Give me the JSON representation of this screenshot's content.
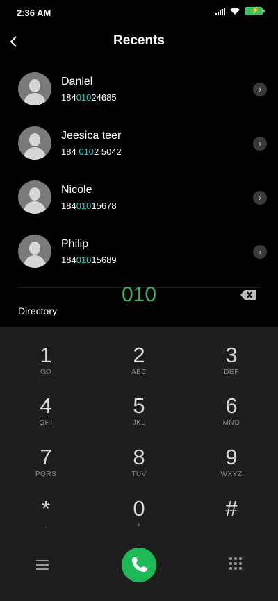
{
  "status_bar": {
    "time": "2:36 AM"
  },
  "header": {
    "title": "Recents"
  },
  "recents": [
    {
      "name": "Daniel",
      "number_prefix": "184",
      "number_match": "010",
      "number_suffix": "24685"
    },
    {
      "name": "Jeesica teer",
      "number_prefix": "184 ",
      "number_match": "010",
      "number_suffix": "2 5042"
    },
    {
      "name": "Nicole",
      "number_prefix": "184",
      "number_match": "010",
      "number_suffix": "15678"
    },
    {
      "name": "Philip",
      "number_prefix": "184",
      "number_match": "010",
      "number_suffix": "15689"
    }
  ],
  "directory_label": "Directory",
  "dialed_number": "010",
  "keypad": {
    "k1": {
      "digit": "1",
      "letters": ""
    },
    "k2": {
      "digit": "2",
      "letters": "ABC"
    },
    "k3": {
      "digit": "3",
      "letters": "DEF"
    },
    "k4": {
      "digit": "4",
      "letters": "GHI"
    },
    "k5": {
      "digit": "5",
      "letters": "JKL"
    },
    "k6": {
      "digit": "6",
      "letters": "MNO"
    },
    "k7": {
      "digit": "7",
      "letters": "PQRS"
    },
    "k8": {
      "digit": "8",
      "letters": "TUV"
    },
    "k9": {
      "digit": "9",
      "letters": "WXYZ"
    },
    "kstar": {
      "digit": "*",
      "letters": ","
    },
    "k0": {
      "digit": "0",
      "letters": "+"
    },
    "khash": {
      "digit": "#",
      "letters": ""
    }
  },
  "colors": {
    "accent_number": "#2ec7c9",
    "dialed": "#3cb15e",
    "call_button": "#1fb856"
  }
}
